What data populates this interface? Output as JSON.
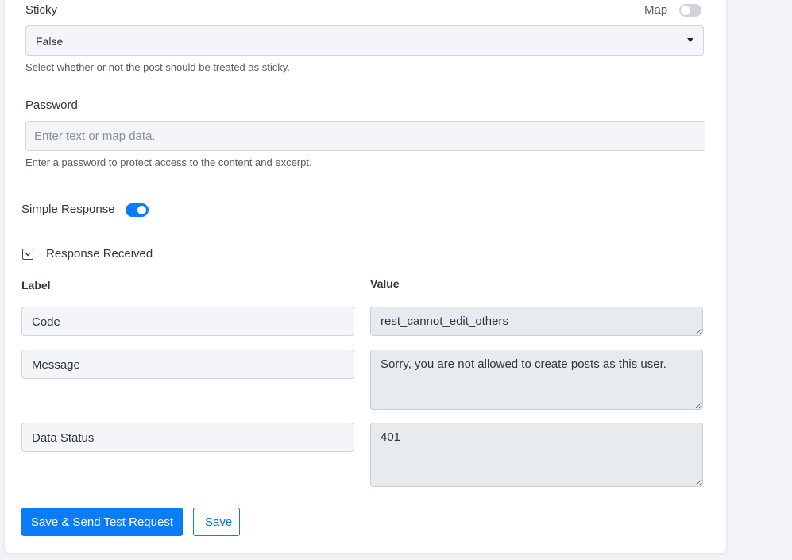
{
  "sticky": {
    "label": "Sticky",
    "map_label": "Map",
    "map_toggle_on": false,
    "selected": "False",
    "help": "Select whether or not the post should be treated as sticky."
  },
  "password": {
    "label": "Password",
    "placeholder": "Enter text or map data.",
    "value": "",
    "help": "Enter a password to protect access to the content and excerpt."
  },
  "simple_response": {
    "label": "Simple Response",
    "enabled": true
  },
  "response_received": {
    "title": "Response Received",
    "label_header": "Label",
    "value_header": "Value",
    "rows": [
      {
        "label": "Code",
        "value": "rest_cannot_edit_others"
      },
      {
        "label": "Message",
        "value": "Sorry, you are not allowed to create posts as this user."
      },
      {
        "label": "Data Status",
        "value": "401"
      }
    ]
  },
  "actions": {
    "save_and_send": "Save & Send Test Request",
    "save": "Save"
  },
  "colors": {
    "accent": "#0a7cf6",
    "background": "#f1f3f6",
    "card": "#ffffff"
  }
}
